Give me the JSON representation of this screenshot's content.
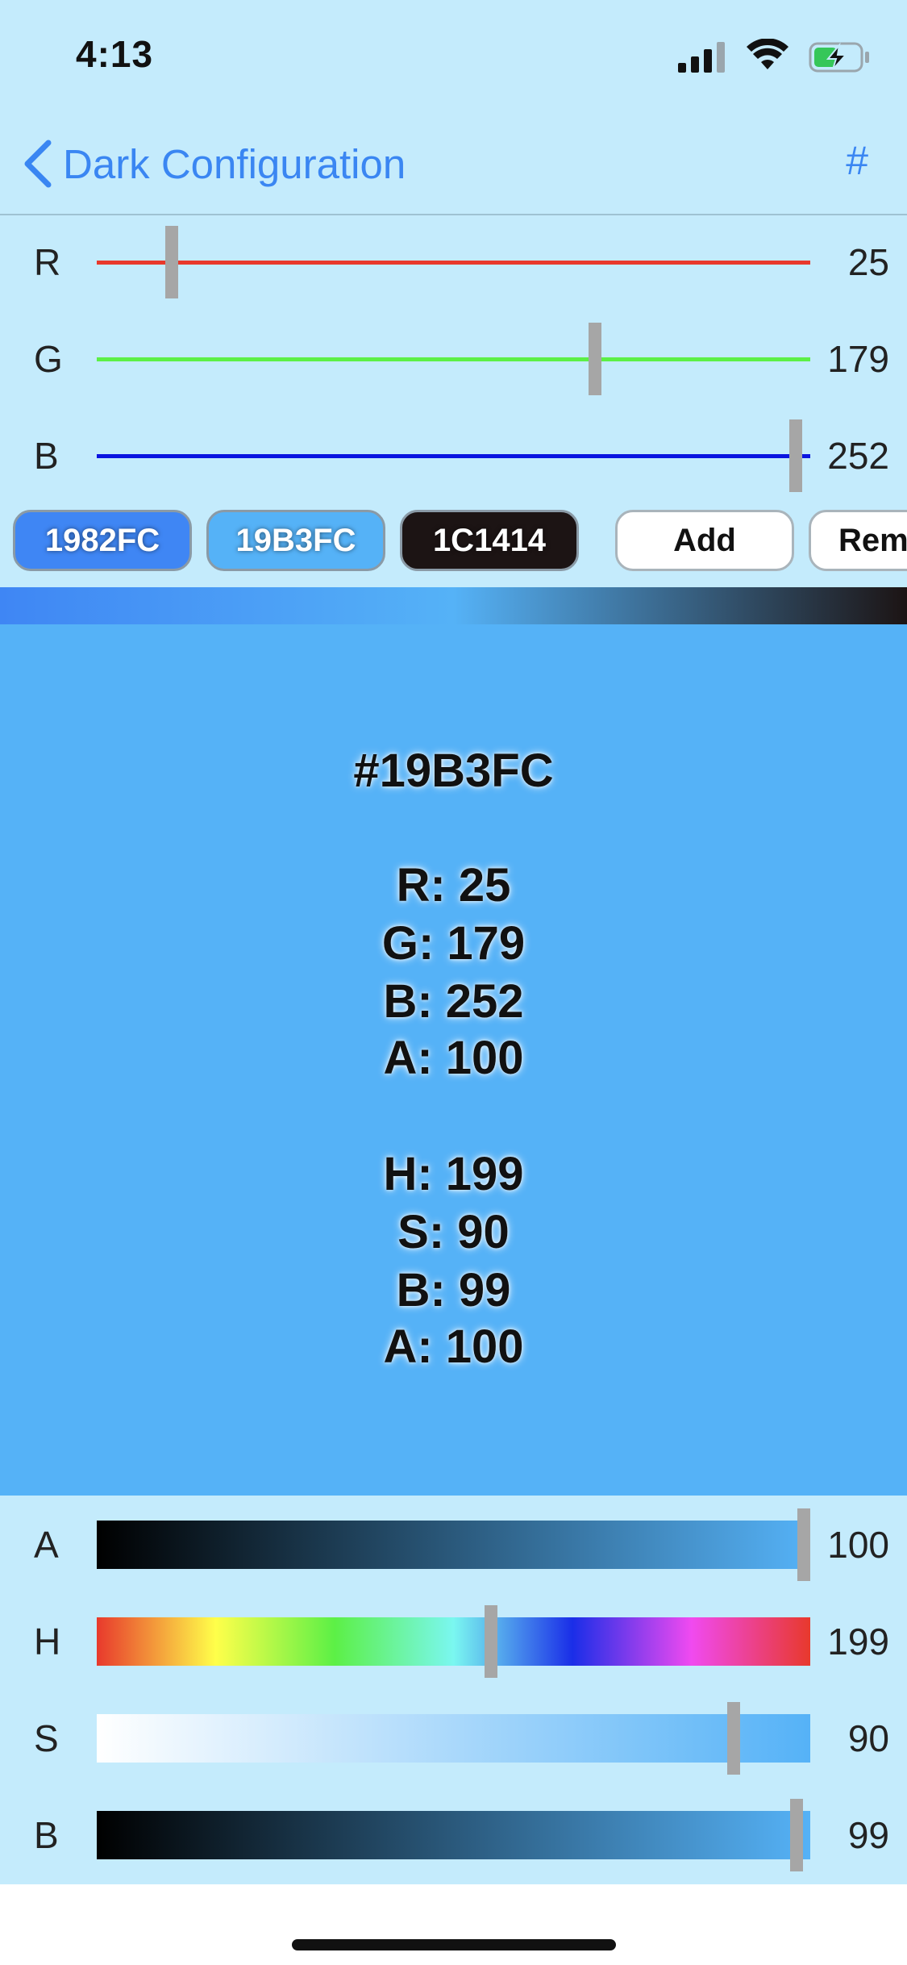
{
  "status_bar": {
    "time": "4:13",
    "icons": [
      "cellular-signal-icon",
      "wifi-icon",
      "battery-charging-icon"
    ]
  },
  "nav": {
    "back_label": "Dark Configuration",
    "action_label": "#",
    "tint": "#3a86f2"
  },
  "rgb_sliders": [
    {
      "letter": "R",
      "value": "25",
      "fraction": 0.098,
      "color": "#e8392c"
    },
    {
      "letter": "G",
      "value": "179",
      "fraction": 0.702,
      "color": "#5cf046"
    },
    {
      "letter": "B",
      "value": "252",
      "fraction": 0.988,
      "color": "#0a14e0"
    }
  ],
  "chips": [
    {
      "label": "1982FC",
      "color": "#3f86f4"
    },
    {
      "label": "19B3FC",
      "color": "#55b2f7"
    },
    {
      "label": "1C1414",
      "color": "#1c1414"
    },
    {
      "label": "Add"
    },
    {
      "label": "Rem"
    }
  ],
  "gradient_colors": [
    "#3f86f4",
    "#55b2f7",
    "#1c1414"
  ],
  "preview": {
    "background": "#55b2f7",
    "hex": "#19B3FC",
    "rgba": [
      "R: 25",
      "G: 179",
      "B: 252",
      "A: 100"
    ],
    "hsba": [
      "H: 199",
      "S: 90",
      "B: 99",
      "A: 100"
    ]
  },
  "hsba_sliders": [
    {
      "letter": "A",
      "value": "100",
      "fraction": 1.0,
      "gradient": [
        "#000000",
        "#55b2f7"
      ]
    },
    {
      "letter": "H",
      "value": "199",
      "fraction": 0.553,
      "gradient": [
        "#e8392c",
        "#ffff4a",
        "#5cf046",
        "#7af7f0",
        "#1a2ee8",
        "#f04af0",
        "#e8392c"
      ]
    },
    {
      "letter": "S",
      "value": "90",
      "fraction": 0.9,
      "gradient": [
        "#ffffff",
        "#55b2f7"
      ]
    },
    {
      "letter": "B",
      "value": "99",
      "fraction": 0.99,
      "gradient": [
        "#000000",
        "#55b2f7"
      ]
    }
  ]
}
